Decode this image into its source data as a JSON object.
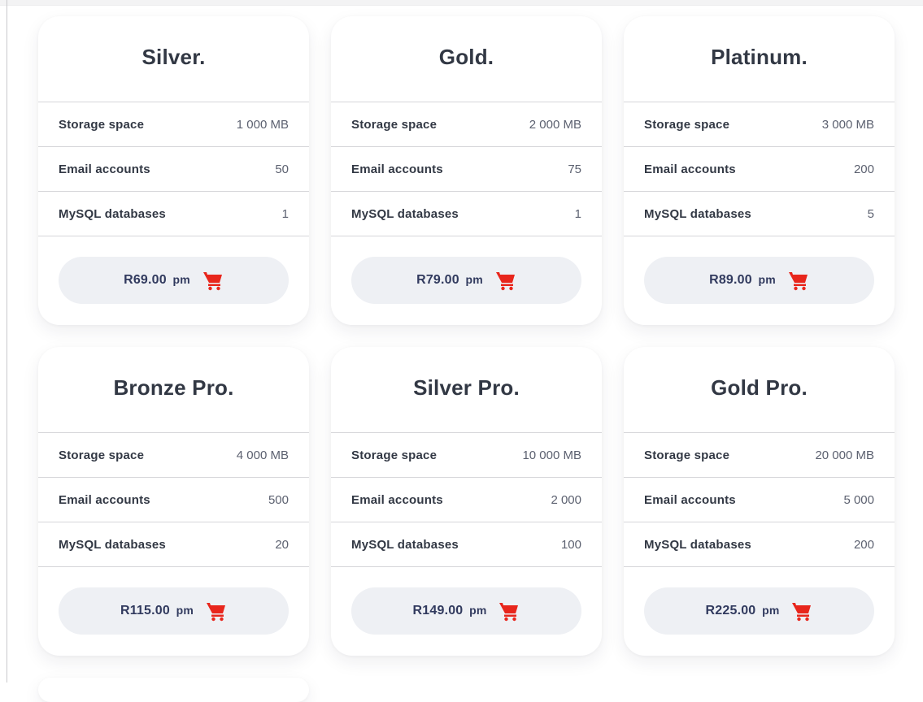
{
  "brand_colors": {
    "title": "#323844",
    "price_text": "#313a5e",
    "button_bg": "#eef0f4",
    "cart_icon": "#e8261c"
  },
  "plans": [
    {
      "name": "Silver.",
      "features": [
        {
          "label": "Storage space",
          "value": "1 000 MB"
        },
        {
          "label": "Email accounts",
          "value": "50"
        },
        {
          "label": "MySQL databases",
          "value": "1"
        }
      ],
      "price": "R69.00",
      "period": "pm"
    },
    {
      "name": "Gold.",
      "features": [
        {
          "label": "Storage space",
          "value": "2 000 MB"
        },
        {
          "label": "Email accounts",
          "value": "75"
        },
        {
          "label": "MySQL databases",
          "value": "1"
        }
      ],
      "price": "R79.00",
      "period": "pm"
    },
    {
      "name": "Platinum.",
      "features": [
        {
          "label": "Storage space",
          "value": "3 000 MB"
        },
        {
          "label": "Email accounts",
          "value": "200"
        },
        {
          "label": "MySQL databases",
          "value": "5"
        }
      ],
      "price": "R89.00",
      "period": "pm"
    },
    {
      "name": "Bronze Pro.",
      "features": [
        {
          "label": "Storage space",
          "value": "4 000 MB"
        },
        {
          "label": "Email accounts",
          "value": "500"
        },
        {
          "label": "MySQL databases",
          "value": "20"
        }
      ],
      "price": "R115.00",
      "period": "pm"
    },
    {
      "name": "Silver Pro.",
      "features": [
        {
          "label": "Storage space",
          "value": "10 000 MB"
        },
        {
          "label": "Email accounts",
          "value": "2 000"
        },
        {
          "label": "MySQL databases",
          "value": "100"
        }
      ],
      "price": "R149.00",
      "period": "pm"
    },
    {
      "name": "Gold Pro.",
      "features": [
        {
          "label": "Storage space",
          "value": "20 000 MB"
        },
        {
          "label": "Email accounts",
          "value": "5 000"
        },
        {
          "label": "MySQL databases",
          "value": "200"
        }
      ],
      "price": "R225.00",
      "period": "pm"
    }
  ]
}
